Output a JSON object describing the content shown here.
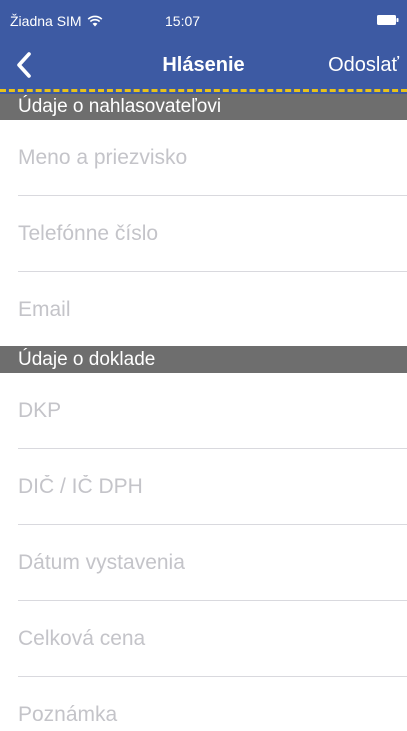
{
  "status_bar": {
    "carrier": "Žiadna SIM",
    "time": "15:07"
  },
  "nav": {
    "title": "Hlásenie",
    "send_label": "Odoslať"
  },
  "reporter_section": {
    "title": "Údaje o nahlasovateľovi",
    "fields": [
      {
        "placeholder": "Meno a priezvisko",
        "value": ""
      },
      {
        "placeholder": "Telefónne číslo",
        "value": ""
      },
      {
        "placeholder": "Email",
        "value": ""
      }
    ]
  },
  "receipt_section": {
    "title": "Údaje o doklade",
    "fields": [
      {
        "placeholder": "DKP",
        "value": ""
      },
      {
        "placeholder": "DIČ / IČ DPH",
        "value": ""
      },
      {
        "placeholder": "Dátum vystavenia",
        "value": ""
      },
      {
        "placeholder": "Celková cena",
        "value": ""
      },
      {
        "placeholder": "Poznámka",
        "value": ""
      }
    ]
  },
  "colors": {
    "header_background": "#3d5aa3",
    "dashed_accent": "#e8c21a",
    "section_background": "#6e6e6e",
    "placeholder": "#c4c4c9"
  },
  "icons": {
    "wifi": "wifi-icon",
    "battery": "battery-icon",
    "back": "chevron-left-icon"
  }
}
